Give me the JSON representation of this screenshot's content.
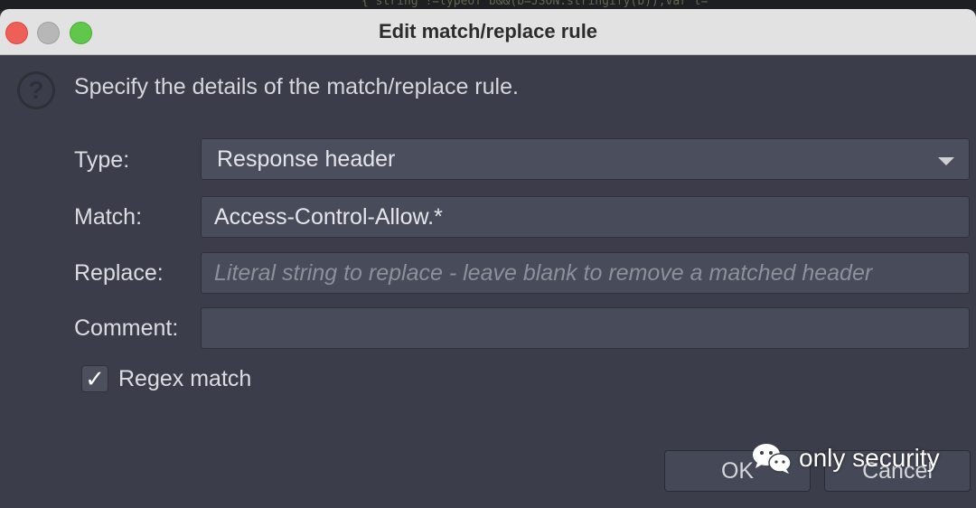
{
  "background": {
    "code_snippet": "{ string !=typeof b&&(b=JSON.stringify(b)),var t="
  },
  "window": {
    "title": "Edit match/replace rule"
  },
  "dialog": {
    "instruction": "Specify the details of the match/replace rule.",
    "type": {
      "label": "Type:",
      "selected": "Response header"
    },
    "match": {
      "label": "Match:",
      "value": "Access-Control-Allow.*"
    },
    "replace": {
      "label": "Replace:",
      "value": "",
      "placeholder": "Literal string to replace - leave blank to remove a matched header"
    },
    "comment": {
      "label": "Comment:",
      "value": ""
    },
    "regex": {
      "label": "Regex match",
      "checked": true,
      "check_glyph": "✓"
    },
    "buttons": {
      "ok": "OK",
      "cancel": "Cancel"
    }
  },
  "watermark": {
    "text": "only security"
  },
  "colors": {
    "dialog_bg": "#3b3e4a",
    "field_bg": "#484b59",
    "titlebar_bg": "#e2e2e2",
    "close": "#ee5f57",
    "maximize": "#5fc84b"
  }
}
